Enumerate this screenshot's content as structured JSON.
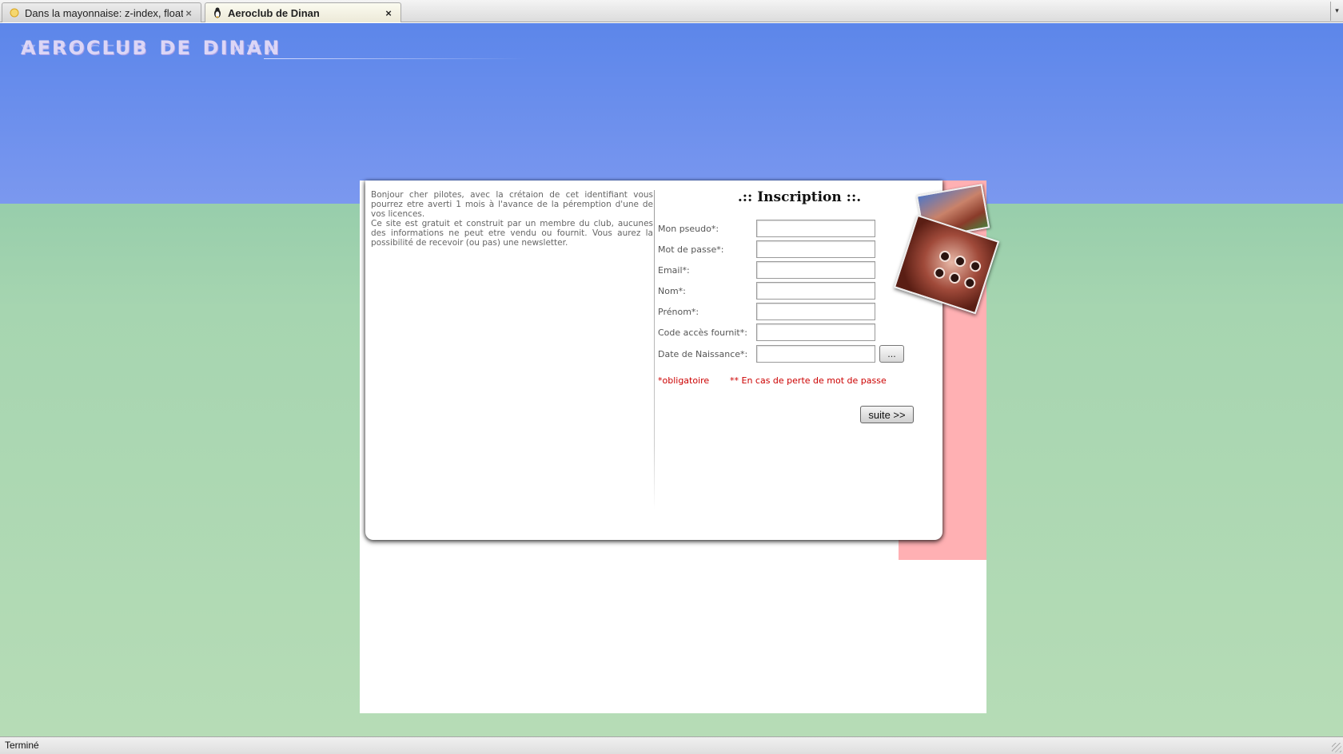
{
  "browser": {
    "tabs": [
      {
        "label": "Dans la mayonnaise: z-index, float e...",
        "icon": "sun-favicon-icon",
        "active": false
      },
      {
        "label": "Aeroclub de Dinan",
        "icon": "penguin-favicon-icon",
        "active": true
      }
    ],
    "close_glyph": "×",
    "tab_list_glyph": "▾",
    "status": "Terminé"
  },
  "header": {
    "logo_text": "aeroclub de dinan"
  },
  "intro": {
    "paragraph1": "Bonjour cher pilotes, avec la crétaion de cet identifiant vous pourrez etre averti 1 mois à l'avance de la péremption d'une de vos licences.",
    "paragraph2": "Ce site est gratuit et construit par un membre du club, aucunes des informations ne peut etre vendu ou fournit. Vous aurez la possibilité de recevoir (ou pas) une newsletter."
  },
  "form": {
    "title": ".:: Inscription ::.",
    "fields": [
      {
        "label": "Mon pseudo*:",
        "value": ""
      },
      {
        "label": "Mot de passe*:",
        "value": ""
      },
      {
        "label": "Email*:",
        "value": ""
      },
      {
        "label": "Nom*:",
        "value": ""
      },
      {
        "label": "Prénom*:",
        "value": ""
      },
      {
        "label": "Code accès fournit*:",
        "value": ""
      },
      {
        "label": "Date de Naissance*:",
        "value": ""
      }
    ],
    "date_picker_label": "...",
    "mandatory_note": "*obligatoire",
    "lost_password_note": "** En cas de perte de mot de passe",
    "next_label": "suite >>"
  },
  "colors": {
    "sky": "#5c86ea",
    "ground": "#a6d5b0",
    "pink_bar": "#ffb0b3",
    "note_red": "#cc0000"
  }
}
